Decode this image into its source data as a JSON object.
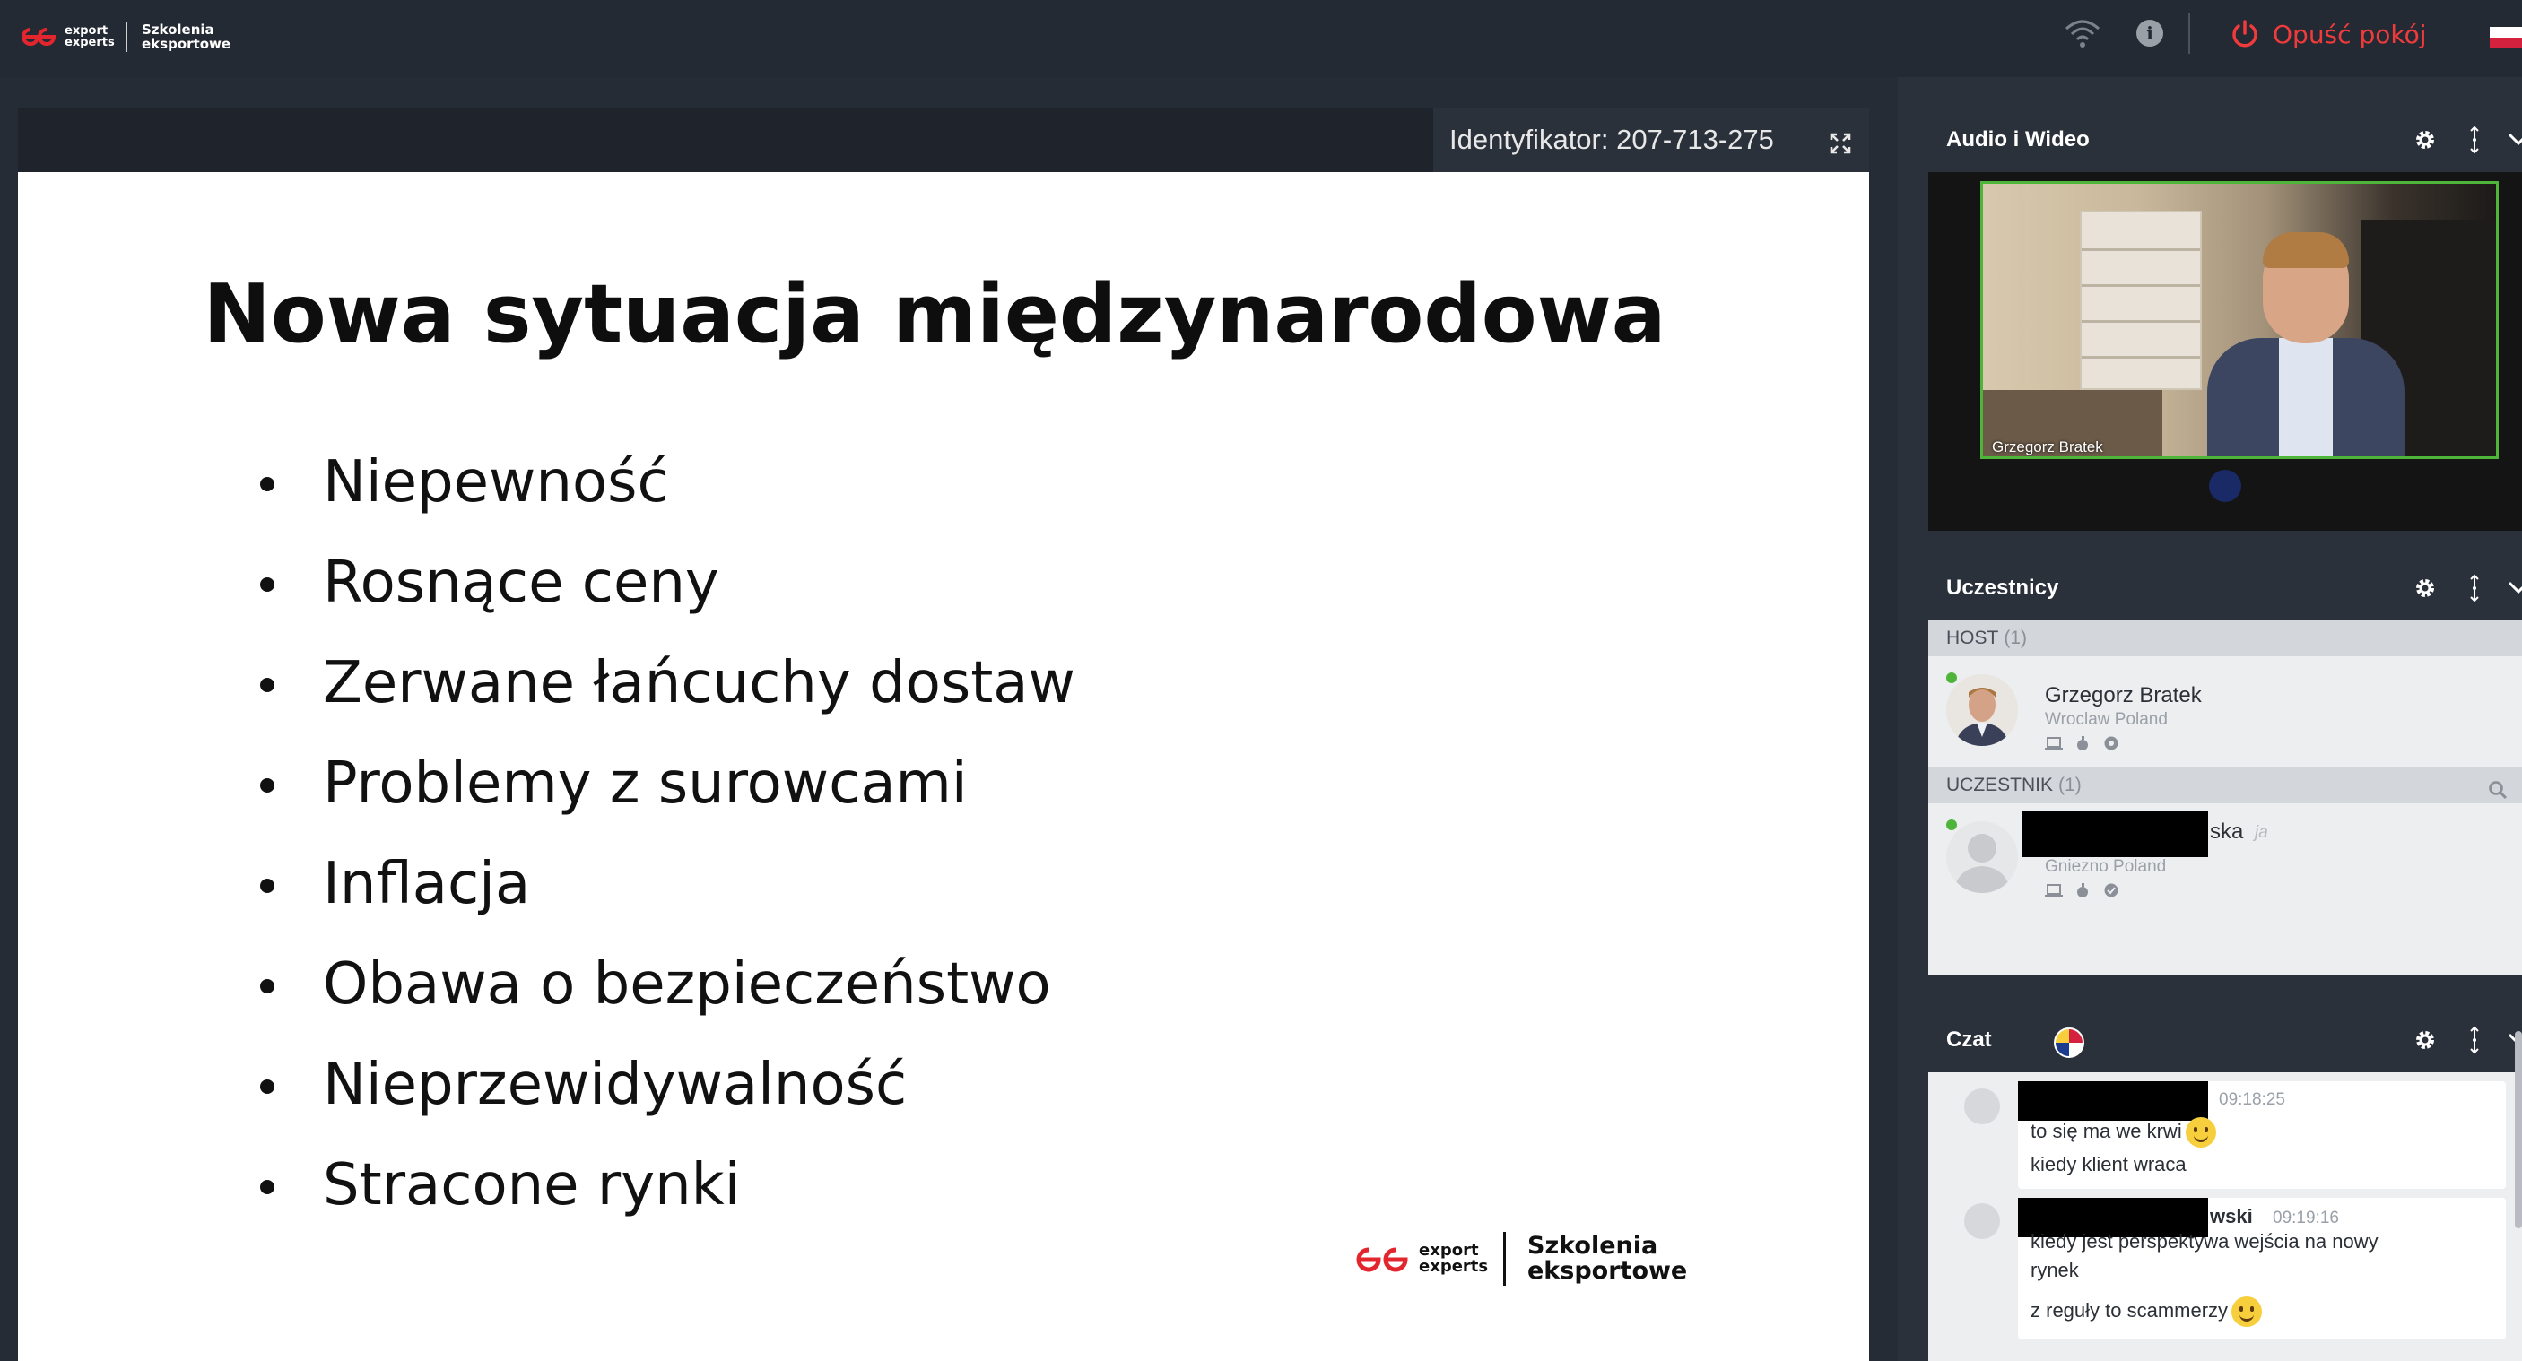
{
  "topbar": {
    "brand_small": "export experts",
    "brand_name": "Szkolenia eksportowe",
    "leave_label": "Opuść pokój",
    "info_glyph": "i",
    "icons": [
      "wifi-icon",
      "info-icon",
      "power-icon"
    ]
  },
  "stage": {
    "id_label": "Identyfikator: 207-713-275"
  },
  "slide": {
    "title": "Nowa sytuacja międzynarodowa",
    "bullets": [
      "Niepewność",
      "Rosnące ceny",
      "Zerwane łańcuchy dostaw",
      "Problemy z surowcami",
      "Inflacja",
      "Obawa o bezpieczeństwo",
      "Nieprzewidywalność",
      "Stracone rynki"
    ],
    "logo_small": "export experts",
    "logo_name": "Szkolenia eksportowe"
  },
  "panels": {
    "video": {
      "title": "Audio i Wideo",
      "speaker_name": "Grzegorz Bratek"
    },
    "participants": {
      "title": "Uczestnicy",
      "host_group": "HOST",
      "host_count": "(1)",
      "host": {
        "name": "Grzegorz Bratek",
        "location": "Wroclaw Poland"
      },
      "attendee_group": "UCZESTNIK",
      "attendee_count": "(1)",
      "attendee": {
        "name_visible": "ska",
        "me_tag": "ja",
        "location": "Gniezno Poland"
      }
    },
    "chat": {
      "title": "Czat",
      "messages": [
        {
          "time": "09:18:25",
          "lines": [
            "to się ma we krwi",
            "kiedy klient wraca"
          ]
        },
        {
          "name_visible": "wski",
          "time": "09:19:16",
          "lines": [
            "kiedy jest perspektywa wejścia na nowy",
            "rynek",
            "z reguły to scammerzy"
          ]
        }
      ]
    }
  },
  "colors": {
    "topbar_bg": "#242a33",
    "panel_bg": "#2a313b",
    "leave_red": "#ef3b3b",
    "online_green": "#4fb43a",
    "brand_red": "#e3262d"
  }
}
